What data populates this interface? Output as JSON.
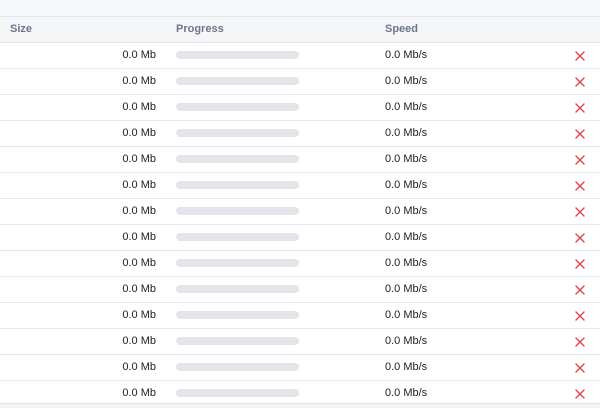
{
  "table": {
    "columns": {
      "size": "Size",
      "progress": "Progress",
      "speed": "Speed"
    },
    "rows": [
      {
        "size": "0.0 Mb",
        "progress": 0,
        "speed": "0.0 Mb/s"
      },
      {
        "size": "0.0 Mb",
        "progress": 0,
        "speed": "0.0 Mb/s"
      },
      {
        "size": "0.0 Mb",
        "progress": 0,
        "speed": "0.0 Mb/s"
      },
      {
        "size": "0.0 Mb",
        "progress": 0,
        "speed": "0.0 Mb/s"
      },
      {
        "size": "0.0 Mb",
        "progress": 0,
        "speed": "0.0 Mb/s"
      },
      {
        "size": "0.0 Mb",
        "progress": 0,
        "speed": "0.0 Mb/s"
      },
      {
        "size": "0.0 Mb",
        "progress": 0,
        "speed": "0.0 Mb/s"
      },
      {
        "size": "0.0 Mb",
        "progress": 0,
        "speed": "0.0 Mb/s"
      },
      {
        "size": "0.0 Mb",
        "progress": 0,
        "speed": "0.0 Mb/s"
      },
      {
        "size": "0.0 Mb",
        "progress": 0,
        "speed": "0.0 Mb/s"
      },
      {
        "size": "0.0 Mb",
        "progress": 0,
        "speed": "0.0 Mb/s"
      },
      {
        "size": "0.0 Mb",
        "progress": 0,
        "speed": "0.0 Mb/s"
      },
      {
        "size": "0.0 Mb",
        "progress": 0,
        "speed": "0.0 Mb/s"
      },
      {
        "size": "0.0 Mb",
        "progress": 0,
        "speed": "0.0 Mb/s"
      }
    ]
  },
  "icons": {
    "remove": "close-icon"
  },
  "colors": {
    "remove_icon": "#e0454b",
    "progress_track": "#e3e5ea",
    "header_text": "#6c7689"
  }
}
